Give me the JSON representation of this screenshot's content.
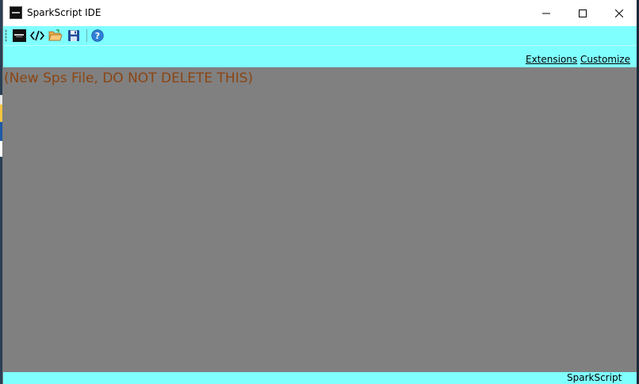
{
  "window": {
    "title": "SparkScript IDE"
  },
  "toolbar": {
    "buttons": [
      {
        "name": "app-logo-icon",
        "tooltip": ""
      },
      {
        "name": "code-icon",
        "tooltip": ""
      },
      {
        "name": "open-folder-icon",
        "tooltip": ""
      },
      {
        "name": "save-icon",
        "tooltip": ""
      },
      {
        "name": "help-icon",
        "tooltip": ""
      }
    ]
  },
  "links": {
    "extensions": "Extensions",
    "customize": "Customize"
  },
  "editor": {
    "content": "(New Sps File, DO NOT DELETE THIS)",
    "text_color": "#8b4513",
    "background": "#808080"
  },
  "status": {
    "label": "SparkScript"
  },
  "colors": {
    "toolbar": "#80ffff",
    "statusbar": "#80ffff"
  }
}
